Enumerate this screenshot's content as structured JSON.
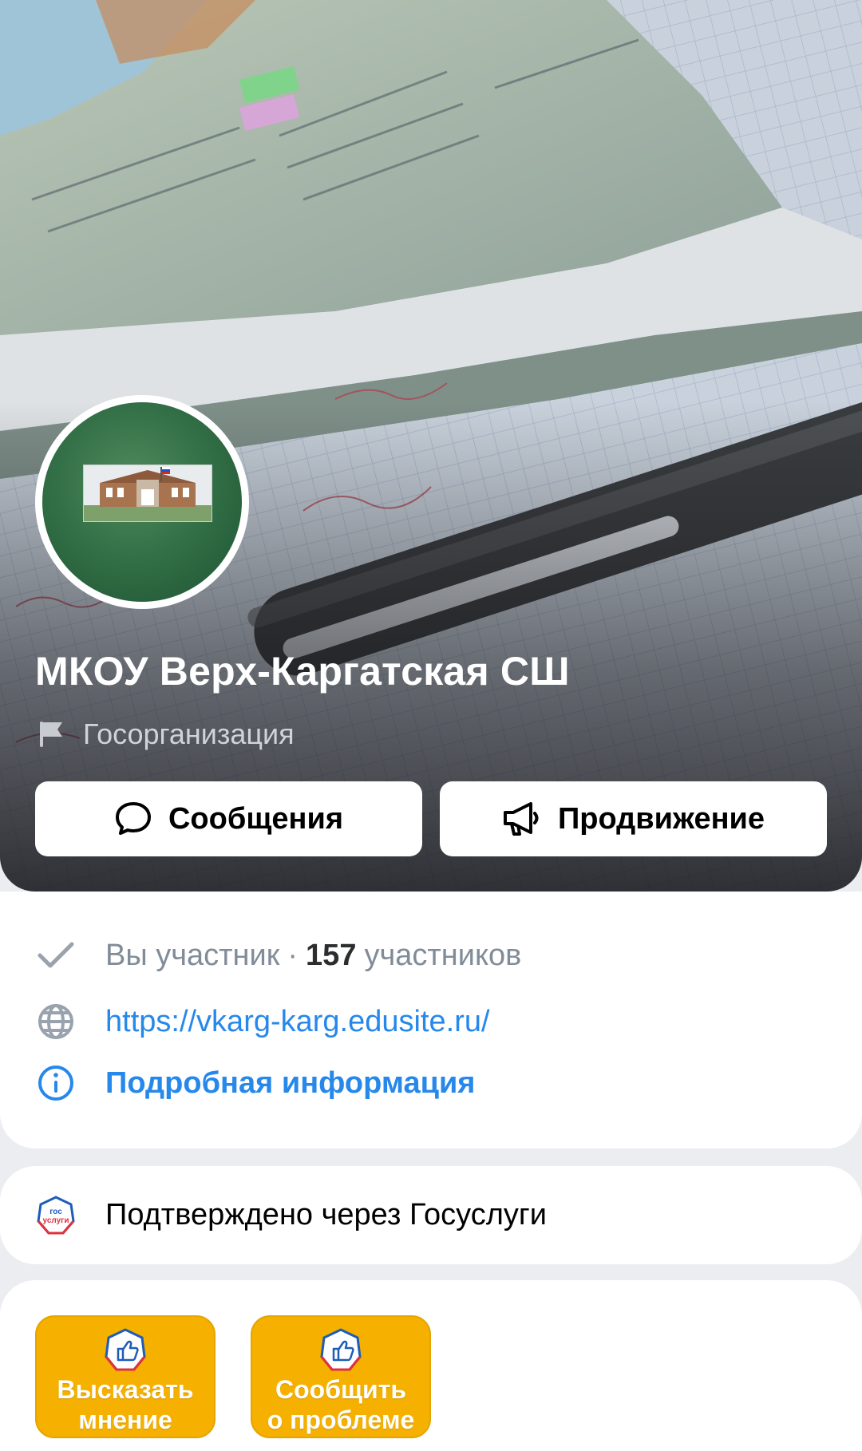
{
  "header": {
    "group_name": "МКОУ Верх-Каргатская СШ",
    "group_type": "Госорганизация",
    "messages_label": "Сообщения",
    "promotion_label": "Продвижение"
  },
  "info": {
    "member_status": "Вы участник",
    "separator": "·",
    "member_count": "157",
    "member_count_label": "участников",
    "website": "https://vkarg-karg.edusite.ru/",
    "details_label": "Подробная информация"
  },
  "verification": {
    "text": "Подтверждено через Госуслуги",
    "logo_text_top": "гос",
    "logo_text_bottom": "услуги"
  },
  "actions": [
    {
      "label_line1": "Высказать",
      "label_line2": "мнение"
    },
    {
      "label_line1": "Сообщить",
      "label_line2": "о проблеме"
    }
  ],
  "colors": {
    "accent_blue": "#2688eb",
    "tile_yellow": "#f5b000",
    "muted_gray": "#818c99"
  }
}
